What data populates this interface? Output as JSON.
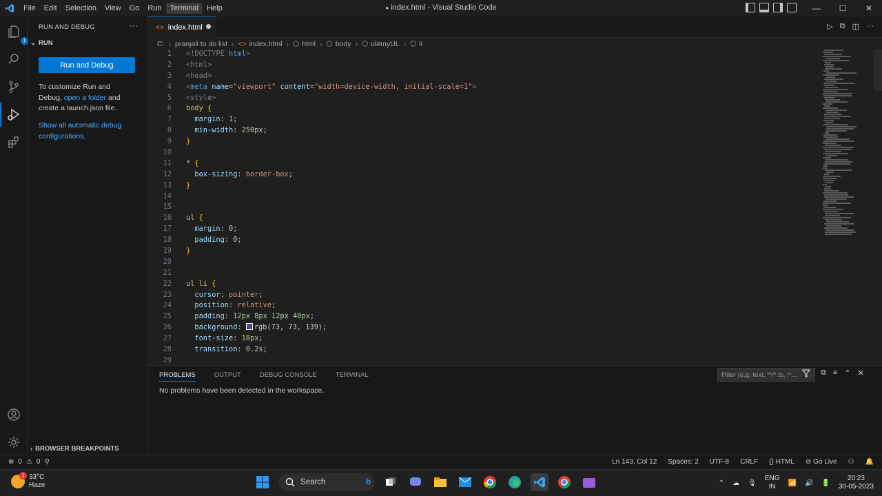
{
  "window": {
    "title": "index.html - Visual Studio Code",
    "menu": [
      "File",
      "Edit",
      "Selection",
      "View",
      "Go",
      "Run",
      "Terminal",
      "Help"
    ],
    "active_menu": "Terminal",
    "controls": [
      "—",
      "☐",
      "✕"
    ]
  },
  "activity_bar": {
    "items": [
      "explorer-icon",
      "search-icon",
      "source-control-icon",
      "run-debug-icon",
      "extensions-icon"
    ],
    "active": "run-debug-icon",
    "explorer_badge": "1",
    "bottom": [
      "account-icon",
      "settings-gear-icon"
    ]
  },
  "sidebar": {
    "title": "RUN AND DEBUG",
    "more": "···",
    "section": "RUN",
    "run_button": "Run and Debug",
    "text1_a": "To customize Run and Debug,",
    "text1_link": "open a folder",
    "text1_b": "and create a launch.json file.",
    "link2": "Show all automatic debug configurations",
    "link2_end": ".",
    "bottom_section": "BROWSER BREAKPOINTS"
  },
  "tab": {
    "label": "index.html"
  },
  "breadcrumb": [
    "C:",
    "pranjali to do list",
    "index.html",
    "html",
    "body",
    "ul#myUL",
    "li"
  ],
  "editor": {
    "line_numbers": [
      "1",
      "2",
      "3",
      "4",
      "5",
      "6",
      "7",
      "8",
      "9",
      "10",
      "11",
      "12",
      "13",
      "14",
      "15",
      "16",
      "17",
      "18",
      "19",
      "20",
      "21",
      "22",
      "23",
      "24",
      "25",
      "26",
      "27",
      "28",
      "29"
    ],
    "tokens": {
      "l1": "<!DOCTYPE",
      "l1b": "html",
      "l1c": ">",
      "l2": "<html>",
      "l3": "<head>",
      "l4a": "<",
      "l4b": "meta",
      "l4c": "name",
      "l4d": "=",
      "l4e": "\"viewport\"",
      "l4f": "content",
      "l4g": "\"width=device-width, initial-scale=1\"",
      "l4h": ">",
      "l5": "<style>",
      "l6a": "body",
      "l6b": "{",
      "l7a": "margin",
      "l7b": "1",
      "l8a": "min-width",
      "l8b": "250px",
      "l10": "}",
      "l11a": "*",
      "l11b": "{",
      "l12a": "box-sizing",
      "l12b": "border-box",
      "l16a": "ul",
      "l16b": "{",
      "l17a": "margin",
      "l17b": "0",
      "l18a": "padding",
      "l18b": "0",
      "l22a": "ul li",
      "l22b": "{",
      "l23a": "cursor",
      "l23b": "pointer",
      "l24a": "position",
      "l24b": "relative",
      "l25a": "padding",
      "l25b": "12px 8px 12px 40px",
      "l26a": "background",
      "l26b": "rgb(73, 73, 139)",
      "l27a": "font-size",
      "l27b": "18px",
      "l28a": "transition",
      "l28b": "0.2s"
    }
  },
  "panel": {
    "tabs": [
      "PROBLEMS",
      "OUTPUT",
      "DEBUG CONSOLE",
      "TERMINAL"
    ],
    "active_tab": "PROBLEMS",
    "filter_placeholder": "Filter (e.g. text, **/*.ts, !*...",
    "message": "No problems have been detected in the workspace."
  },
  "statusbar": {
    "errors": "0",
    "warnings": "0",
    "position": "Ln 143, Col 12",
    "spaces": "Spaces: 2",
    "encoding": "UTF-8",
    "eol": "CRLF",
    "language": "HTML",
    "golive": "Go Live"
  },
  "taskbar": {
    "temp": "33°C",
    "condition": "Haze",
    "weather_badge": "1",
    "search": "Search",
    "lang1": "ENG",
    "lang2": "IN",
    "time": "20:23",
    "date": "30-05-2023"
  },
  "colors": {
    "accent": "#0078d4",
    "background": "#1f1f1f",
    "sidebar": "#181818"
  }
}
